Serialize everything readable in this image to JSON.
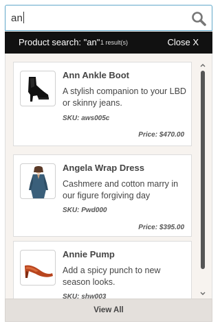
{
  "search": {
    "value": "an",
    "icon": "search-icon"
  },
  "header": {
    "title": "Product search: \"an\"",
    "count": "1 result(s)",
    "close_label": "Close X"
  },
  "products": [
    {
      "name": "Ann Ankle Boot",
      "description": "A stylish companion to your LBD or skinny jeans.",
      "sku": "SKU: aws005c",
      "price": "Price: $470.00",
      "thumb": "black-ankle-boot"
    },
    {
      "name": "Angela Wrap Dress",
      "description": "Cashmere and cotton marry in our figure forgiving day",
      "sku": "SKU: Pwd000",
      "price": "Price: $395.00",
      "thumb": "blue-wrap-dress"
    },
    {
      "name": "Annie Pump",
      "description": "Add a spicy punch to new season looks.",
      "sku": "SKU: shw003",
      "price": "",
      "thumb": "red-pump"
    }
  ],
  "footer": {
    "view_all_label": "View All"
  },
  "colors": {
    "accent_border": "#5fa7c9",
    "header_bg": "#111111",
    "panel_bg": "#f7f3ef",
    "footer_bg": "#e4e0dc"
  }
}
